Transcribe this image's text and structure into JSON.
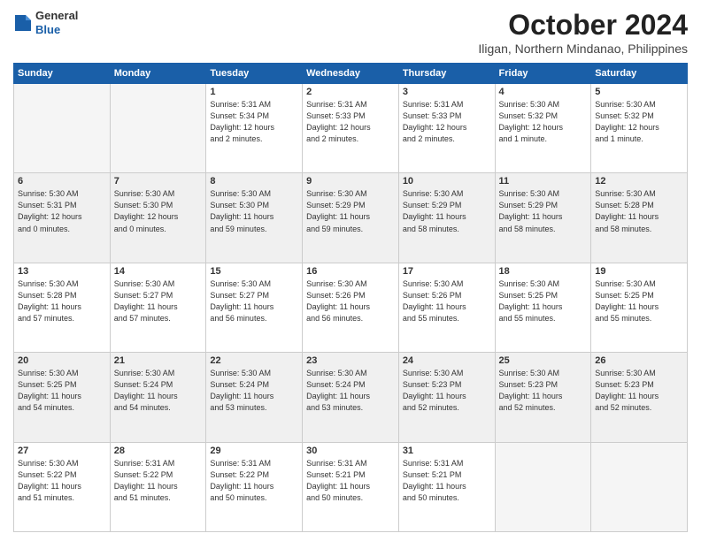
{
  "header": {
    "logo": {
      "general": "General",
      "blue": "Blue"
    },
    "title": "October 2024",
    "location": "Iligan, Northern Mindanao, Philippines"
  },
  "columns": [
    "Sunday",
    "Monday",
    "Tuesday",
    "Wednesday",
    "Thursday",
    "Friday",
    "Saturday"
  ],
  "weeks": [
    {
      "shaded": false,
      "days": [
        {
          "num": "",
          "info": ""
        },
        {
          "num": "",
          "info": ""
        },
        {
          "num": "1",
          "info": "Sunrise: 5:31 AM\nSunset: 5:34 PM\nDaylight: 12 hours\nand 2 minutes."
        },
        {
          "num": "2",
          "info": "Sunrise: 5:31 AM\nSunset: 5:33 PM\nDaylight: 12 hours\nand 2 minutes."
        },
        {
          "num": "3",
          "info": "Sunrise: 5:31 AM\nSunset: 5:33 PM\nDaylight: 12 hours\nand 2 minutes."
        },
        {
          "num": "4",
          "info": "Sunrise: 5:30 AM\nSunset: 5:32 PM\nDaylight: 12 hours\nand 1 minute."
        },
        {
          "num": "5",
          "info": "Sunrise: 5:30 AM\nSunset: 5:32 PM\nDaylight: 12 hours\nand 1 minute."
        }
      ]
    },
    {
      "shaded": true,
      "days": [
        {
          "num": "6",
          "info": "Sunrise: 5:30 AM\nSunset: 5:31 PM\nDaylight: 12 hours\nand 0 minutes."
        },
        {
          "num": "7",
          "info": "Sunrise: 5:30 AM\nSunset: 5:30 PM\nDaylight: 12 hours\nand 0 minutes."
        },
        {
          "num": "8",
          "info": "Sunrise: 5:30 AM\nSunset: 5:30 PM\nDaylight: 11 hours\nand 59 minutes."
        },
        {
          "num": "9",
          "info": "Sunrise: 5:30 AM\nSunset: 5:29 PM\nDaylight: 11 hours\nand 59 minutes."
        },
        {
          "num": "10",
          "info": "Sunrise: 5:30 AM\nSunset: 5:29 PM\nDaylight: 11 hours\nand 58 minutes."
        },
        {
          "num": "11",
          "info": "Sunrise: 5:30 AM\nSunset: 5:29 PM\nDaylight: 11 hours\nand 58 minutes."
        },
        {
          "num": "12",
          "info": "Sunrise: 5:30 AM\nSunset: 5:28 PM\nDaylight: 11 hours\nand 58 minutes."
        }
      ]
    },
    {
      "shaded": false,
      "days": [
        {
          "num": "13",
          "info": "Sunrise: 5:30 AM\nSunset: 5:28 PM\nDaylight: 11 hours\nand 57 minutes."
        },
        {
          "num": "14",
          "info": "Sunrise: 5:30 AM\nSunset: 5:27 PM\nDaylight: 11 hours\nand 57 minutes."
        },
        {
          "num": "15",
          "info": "Sunrise: 5:30 AM\nSunset: 5:27 PM\nDaylight: 11 hours\nand 56 minutes."
        },
        {
          "num": "16",
          "info": "Sunrise: 5:30 AM\nSunset: 5:26 PM\nDaylight: 11 hours\nand 56 minutes."
        },
        {
          "num": "17",
          "info": "Sunrise: 5:30 AM\nSunset: 5:26 PM\nDaylight: 11 hours\nand 55 minutes."
        },
        {
          "num": "18",
          "info": "Sunrise: 5:30 AM\nSunset: 5:25 PM\nDaylight: 11 hours\nand 55 minutes."
        },
        {
          "num": "19",
          "info": "Sunrise: 5:30 AM\nSunset: 5:25 PM\nDaylight: 11 hours\nand 55 minutes."
        }
      ]
    },
    {
      "shaded": true,
      "days": [
        {
          "num": "20",
          "info": "Sunrise: 5:30 AM\nSunset: 5:25 PM\nDaylight: 11 hours\nand 54 minutes."
        },
        {
          "num": "21",
          "info": "Sunrise: 5:30 AM\nSunset: 5:24 PM\nDaylight: 11 hours\nand 54 minutes."
        },
        {
          "num": "22",
          "info": "Sunrise: 5:30 AM\nSunset: 5:24 PM\nDaylight: 11 hours\nand 53 minutes."
        },
        {
          "num": "23",
          "info": "Sunrise: 5:30 AM\nSunset: 5:24 PM\nDaylight: 11 hours\nand 53 minutes."
        },
        {
          "num": "24",
          "info": "Sunrise: 5:30 AM\nSunset: 5:23 PM\nDaylight: 11 hours\nand 52 minutes."
        },
        {
          "num": "25",
          "info": "Sunrise: 5:30 AM\nSunset: 5:23 PM\nDaylight: 11 hours\nand 52 minutes."
        },
        {
          "num": "26",
          "info": "Sunrise: 5:30 AM\nSunset: 5:23 PM\nDaylight: 11 hours\nand 52 minutes."
        }
      ]
    },
    {
      "shaded": false,
      "days": [
        {
          "num": "27",
          "info": "Sunrise: 5:30 AM\nSunset: 5:22 PM\nDaylight: 11 hours\nand 51 minutes."
        },
        {
          "num": "28",
          "info": "Sunrise: 5:31 AM\nSunset: 5:22 PM\nDaylight: 11 hours\nand 51 minutes."
        },
        {
          "num": "29",
          "info": "Sunrise: 5:31 AM\nSunset: 5:22 PM\nDaylight: 11 hours\nand 50 minutes."
        },
        {
          "num": "30",
          "info": "Sunrise: 5:31 AM\nSunset: 5:21 PM\nDaylight: 11 hours\nand 50 minutes."
        },
        {
          "num": "31",
          "info": "Sunrise: 5:31 AM\nSunset: 5:21 PM\nDaylight: 11 hours\nand 50 minutes."
        },
        {
          "num": "",
          "info": ""
        },
        {
          "num": "",
          "info": ""
        }
      ]
    }
  ]
}
